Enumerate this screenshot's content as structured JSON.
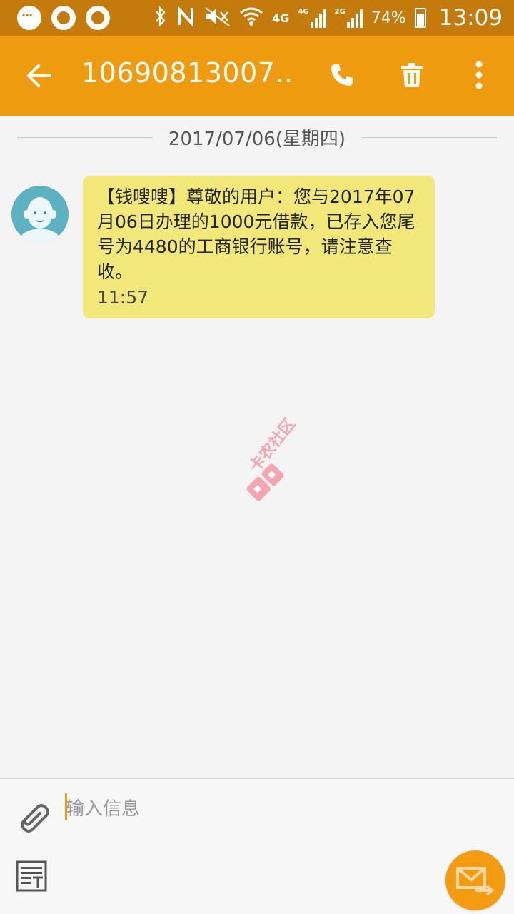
{
  "status_bar": {
    "network_4g": "4G",
    "signal1_label": "4G",
    "signal2_label": "2G",
    "battery": "74%",
    "time": "13:09"
  },
  "header": {
    "title": "10690813007...",
    "back_icon": "arrow-back-icon",
    "call_icon": "phone-icon",
    "delete_icon": "trash-icon",
    "more_icon": "more-vert-icon"
  },
  "conversation": {
    "date": "2017/07/06(星期四)",
    "messages": [
      {
        "text": "【钱嗖嗖】尊敬的用户：您与2017年07月06日办理的1000元借款，已存入您尾号为4480的工商银行账号，请注意查收。",
        "time": "11:57"
      }
    ]
  },
  "watermark": {
    "text": "卡农社区",
    "color": "#f4a6b0"
  },
  "composer": {
    "placeholder": "输入信息"
  },
  "colors": {
    "status_bar": "#c57b0c",
    "app_bar": "#ef9b0f",
    "bubble": "#f2e87a",
    "send_button": "#f39c12",
    "avatar": "#5cb2c0"
  }
}
